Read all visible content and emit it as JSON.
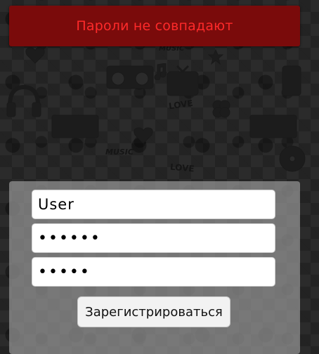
{
  "alert": {
    "message": "Пароли не совпадают",
    "background_color": "#7a0b0b",
    "text_color": "#ff2a2a"
  },
  "form": {
    "login_value": "User",
    "password_value": "••••••",
    "password_confirm_value": "•••••",
    "register_label": "Зарегистрироваться"
  },
  "background": {
    "pattern": "music-doodle-icons",
    "base_color": "#2b2b2b",
    "decor_text_love": "LOVE",
    "decor_text_music": "MUSIC"
  }
}
